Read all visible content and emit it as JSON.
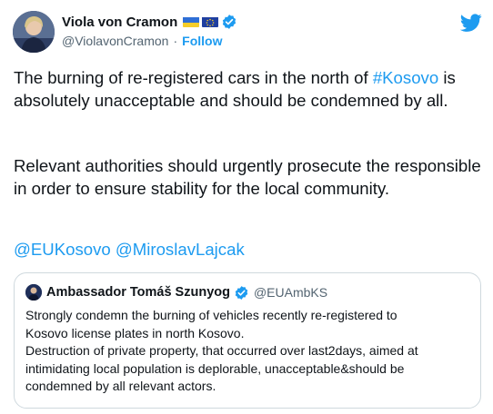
{
  "author": {
    "name": "Viola von Cramon",
    "handle": "@ViolavonCramon",
    "separator": "·",
    "follow_label": "Follow"
  },
  "tweet": {
    "p1_text": "The burning of re-registered cars in the north of ",
    "p1_hashtag": "#Kosovo",
    "p1_rest": " is absolutely unacceptable and should be condemned by all.",
    "p2_text": "Relevant authorities should urgently prosecute the responsible in order to ensure stability for the local community.",
    "mention1": "@EUKosovo",
    "mention2": "@MiroslavLajcak"
  },
  "quote": {
    "name": "Ambassador Tomáš Szunyog",
    "handle": "@EUAmbKS",
    "lines": [
      "Strongly condemn the burning of vehicles recently re-registered to",
      "Kosovo license plates in north Kosovo.",
      "Destruction of private property, that occurred over last2days, aimed at",
      "intimidating local population is deplorable, unacceptable&should be",
      "condemned by all relevant actors."
    ]
  },
  "colors": {
    "accent": "#1d9bf0",
    "text": "#0f1419",
    "muted": "#536471",
    "border": "#cfd9de"
  },
  "icons": {
    "logo": "twitter-bird-icon",
    "verified": "verified-badge-icon",
    "flags": [
      "ukraine-flag-icon",
      "eu-flag-icon"
    ]
  }
}
